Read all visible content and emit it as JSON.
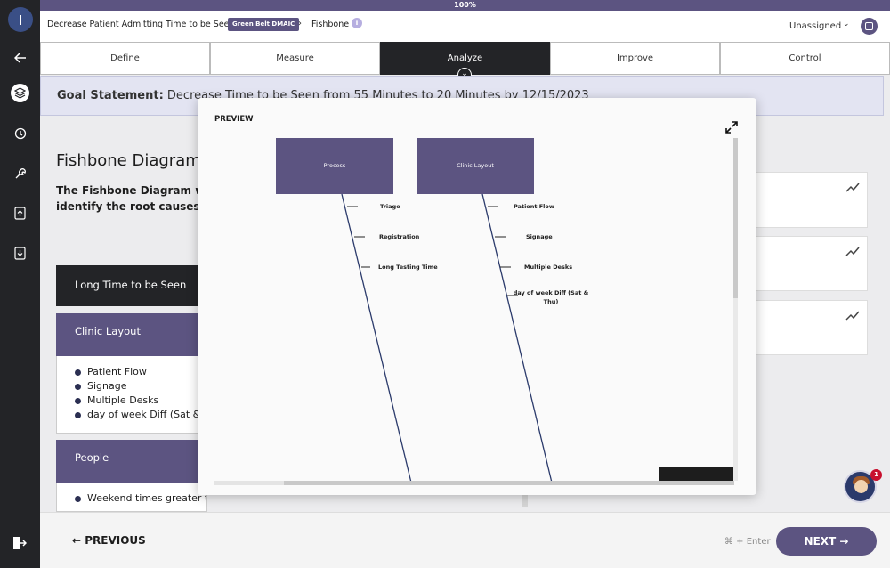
{
  "progress": {
    "label": "100%",
    "value_pct": 100
  },
  "header": {
    "project_title": "Decrease Patient Admitting Time to be Seen",
    "badge": "Green Belt DMAIC",
    "separator": "›",
    "current_tool": "Fishbone",
    "info_glyph": "i",
    "assignee": "Unassigned",
    "chevron": "⌄"
  },
  "tabs": [
    "Define",
    "Measure",
    "Analyze",
    "Improve",
    "Control"
  ],
  "active_tab": "Analyze",
  "tab_chevron": "⌄",
  "goal": {
    "label": "Goal Statement:",
    "text": "Decrease Time to be Seen from 55 Minutes to 20 Minutes by 12/15/2023"
  },
  "main": {
    "title": "Fishbone Diagram",
    "description_line1": "The Fishbone Diagram will",
    "description_line2": "identify the root causes to",
    "effect": "Long Time to be Seen",
    "categories": [
      {
        "name": "Clinic Layout",
        "items": [
          "Patient Flow",
          "Signage",
          "Multiple Desks",
          "day of week Diff (Sat & Thu)"
        ]
      },
      {
        "name": "People",
        "items": [
          "Weekend times greater than weekdays"
        ]
      }
    ]
  },
  "preview": {
    "label": "PREVIEW",
    "boxes": [
      "Process",
      "Clinic Layout"
    ],
    "process_bones": [
      "Triage",
      "Registration",
      "Long Testing Time"
    ],
    "layout_bones": [
      "Patient Flow",
      "Signage",
      "Multiple Desks",
      "day of week Diff (Sat &\nThu)"
    ]
  },
  "chat": {
    "badge_count": "1"
  },
  "footer": {
    "prev_label": "PREVIOUS",
    "shortcut_hint": "⌘ + Enter",
    "next_label": "NEXT"
  },
  "colors": {
    "brand": "#5c5481",
    "dark": "#232427",
    "goal_bg": "#e3e4f2"
  },
  "icons": [
    "back-arrow-icon",
    "layers-icon",
    "clock-icon",
    "wrench-icon",
    "upload-icon",
    "download-icon",
    "exit-icon",
    "trend-icon",
    "expand-icon",
    "notes-icon"
  ]
}
